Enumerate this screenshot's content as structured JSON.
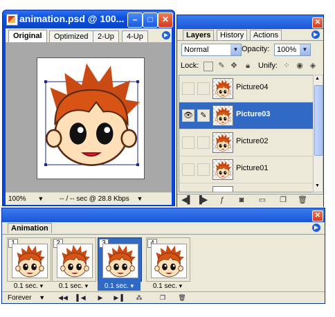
{
  "document_window": {
    "title": "animation.psd @ 100...",
    "tabs": [
      "Original",
      "Optimized",
      "2-Up",
      "4-Up"
    ],
    "zoom": "100%",
    "download_info": "-- / -- sec @ 28.8 Kbps"
  },
  "layers_palette": {
    "tabs": [
      "Layers",
      "History",
      "Actions"
    ],
    "blend_mode": "Normal",
    "opacity_label": "Opacity:",
    "opacity_value": "100%",
    "lock_label": "Lock:",
    "unify_label": "Unify:",
    "layers": [
      {
        "name": "Picture04",
        "visible": false,
        "selected": false
      },
      {
        "name": "Picture03",
        "visible": true,
        "selected": true
      },
      {
        "name": "Picture02",
        "visible": false,
        "selected": false
      },
      {
        "name": "Picture01",
        "visible": false,
        "selected": false
      }
    ]
  },
  "animation_palette": {
    "tab": "Animation",
    "frames": [
      {
        "number": "1",
        "delay": "0.1 sec.",
        "selected": false
      },
      {
        "number": "2",
        "delay": "0.1 sec.",
        "selected": false
      },
      {
        "number": "3",
        "delay": "0.1 sec.",
        "selected": true
      },
      {
        "number": "4",
        "delay": "0.1 sec.",
        "selected": false
      }
    ],
    "loop_option": "Forever"
  },
  "colors": {
    "title_bar": "#0b52df",
    "selection": "#316ac5",
    "palette_bg": "#ece9d8",
    "canvas_gray": "#a8a8a8"
  }
}
